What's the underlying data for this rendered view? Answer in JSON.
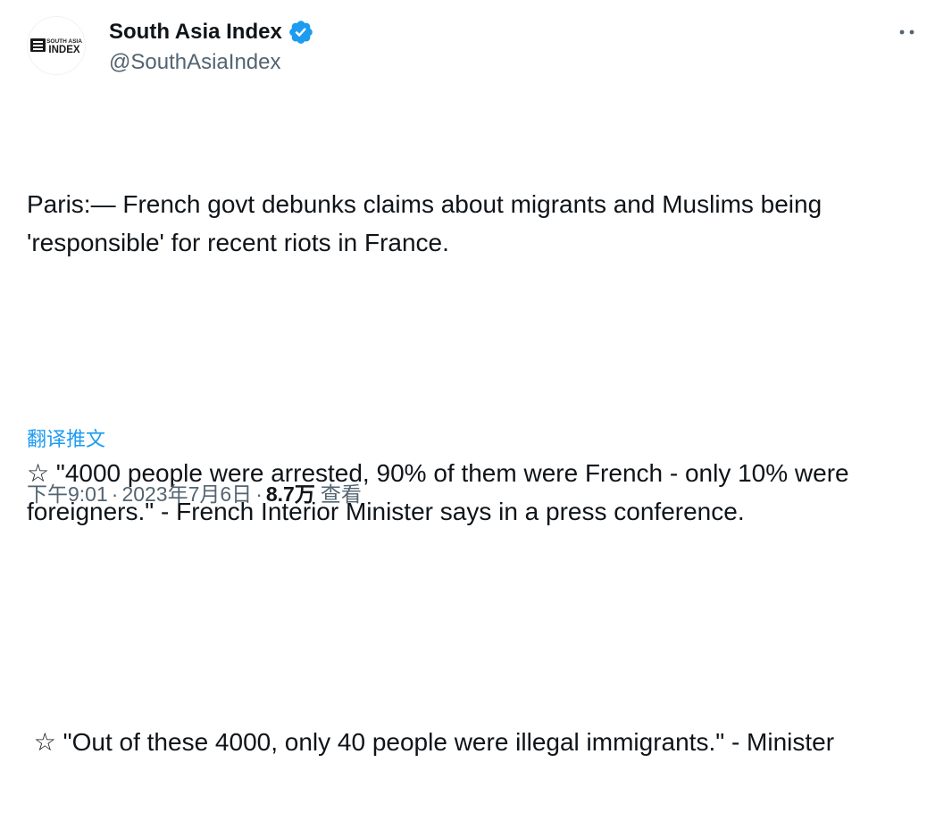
{
  "author": {
    "display_name": "South Asia Index",
    "handle": "@SouthAsiaIndex",
    "logo_line1": "SOUTH ASIA",
    "logo_line2": "INDEX",
    "verified_color": "#1d9bf0"
  },
  "tweet": {
    "paragraphs": [
      "Paris:— French govt debunks claims about migrants and Muslims being 'responsible' for recent riots in France.",
      "☆ \"4000 people were arrested, 90% of them were French - only 10% were foreigners.\" - French Interior Minister says in a press conference.",
      " ☆ \"Out of these 4000, only 40 people were illegal immigrants.\" - Minister"
    ],
    "translate_label": "翻译推文"
  },
  "meta": {
    "time": "下午9:01",
    "date": "2023年7月6日",
    "separator": "·",
    "views_count": "8.7万",
    "views_label": "查看"
  },
  "colors": {
    "text": "#0f1419",
    "secondary": "#536471",
    "link": "#1d9bf0"
  }
}
